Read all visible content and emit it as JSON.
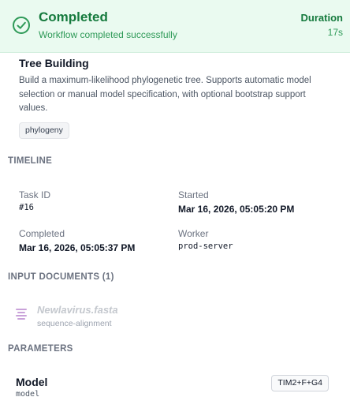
{
  "status": {
    "title": "Completed",
    "subtitle": "Workflow completed successfully",
    "duration_label": "Duration",
    "duration_value": "17s",
    "color": "#157a3d",
    "background": "#eafaf0"
  },
  "tool": {
    "name": "Tree Building",
    "description": "Build a maximum-likelihood phylogenetic tree. Supports automatic model selection or manual model specification, with optional bootstrap support values.",
    "tag": "phylogeny"
  },
  "timeline": {
    "heading": "TIMELINE",
    "task_id_label": "Task ID",
    "task_id_value": "#16",
    "started_label": "Started",
    "started_value": "Mar 16, 2026, 05:05:20 PM",
    "completed_label": "Completed",
    "completed_value": "Mar 16, 2026, 05:05:37 PM",
    "worker_label": "Worker",
    "worker_value": "prod-server"
  },
  "inputs": {
    "heading": "INPUT DOCUMENTS (1)",
    "documents": [
      {
        "name": "Newlavirus.fasta",
        "type": "sequence-alignment",
        "icon": "document-lines-icon"
      }
    ]
  },
  "parameters": {
    "heading": "PARAMETERS",
    "items": [
      {
        "name": "Model",
        "key": "model",
        "value": "TIM2+F+G4"
      }
    ]
  }
}
